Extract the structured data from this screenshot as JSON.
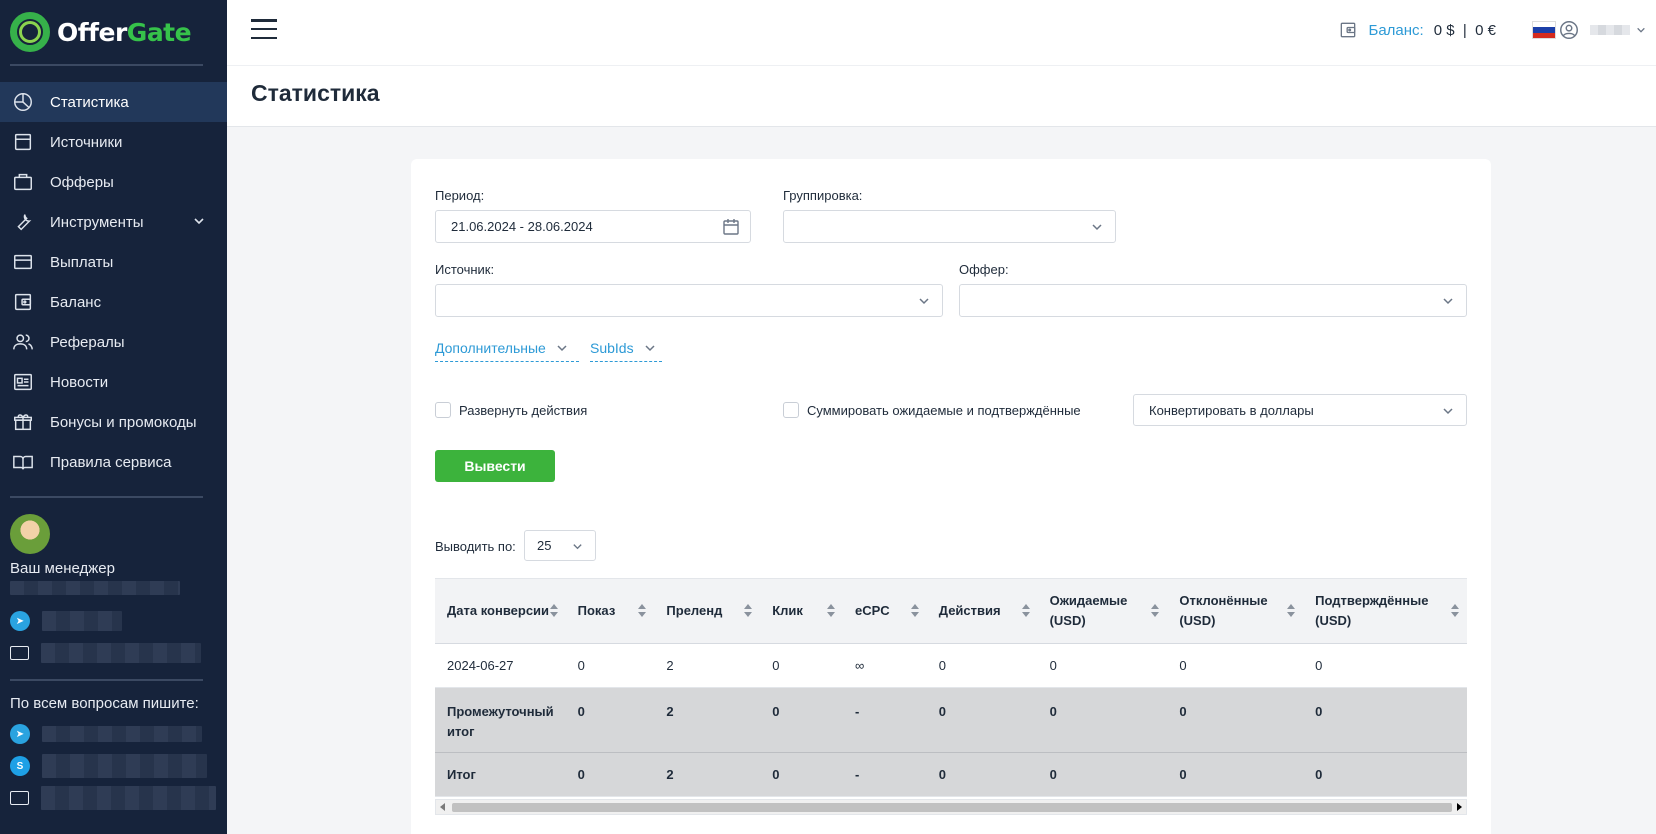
{
  "brand": {
    "part1": "Offer",
    "part2": "Gate"
  },
  "sidebar": {
    "items": [
      {
        "label": "Статистика",
        "icon": "pie-chart-icon",
        "active": true
      },
      {
        "label": "Источники",
        "icon": "window-icon"
      },
      {
        "label": "Офферы",
        "icon": "briefcase-icon"
      },
      {
        "label": "Инструменты",
        "icon": "wrench-icon",
        "has_children": true
      },
      {
        "label": "Выплаты",
        "icon": "credit-card-icon"
      },
      {
        "label": "Баланс",
        "icon": "wallet-icon"
      },
      {
        "label": "Рефералы",
        "icon": "users-icon"
      },
      {
        "label": "Новости",
        "icon": "news-icon"
      },
      {
        "label": "Бонусы и промокоды",
        "icon": "gift-icon"
      },
      {
        "label": "Правила сервиса",
        "icon": "book-icon"
      }
    ],
    "manager_label": "Ваш менеджер",
    "ask_label": "По всем вопросам пишите:"
  },
  "header": {
    "balance_label": "Баланс:",
    "balance_value": "0 $  |  0 €",
    "page_title": "Статистика"
  },
  "filters": {
    "period_label": "Период:",
    "period_value": "21.06.2024 - 28.06.2024",
    "grouping_label": "Группировка:",
    "source_label": "Источник:",
    "offer_label": "Оффер:",
    "extra_label": "Дополнительные",
    "subids_label": "SubIds",
    "expand_actions_label": "Развернуть действия",
    "sum_label": "Суммировать ожидаемые и подтверждённые",
    "convert_value": "Конвертировать в доллары",
    "submit_label": "Вывести",
    "per_page_label": "Выводить по:",
    "per_page_value": "25"
  },
  "table": {
    "columns": [
      "Дата конверсии",
      "Показ",
      "Преленд",
      "Клик",
      "eCPC",
      "Действия",
      "Ожидаемые (USD)",
      "Отклонённые (USD)",
      "Подтверждённые (USD)"
    ],
    "rows": [
      [
        "2024-06-27",
        "0",
        "2",
        "0",
        "∞",
        "0",
        "0",
        "0",
        "0"
      ]
    ],
    "subtotal": [
      "Промежуточный итог",
      "0",
      "2",
      "0",
      "-",
      "0",
      "0",
      "0",
      "0"
    ],
    "total": [
      "Итог",
      "0",
      "2",
      "0",
      "-",
      "0",
      "0",
      "0",
      "0"
    ]
  }
}
